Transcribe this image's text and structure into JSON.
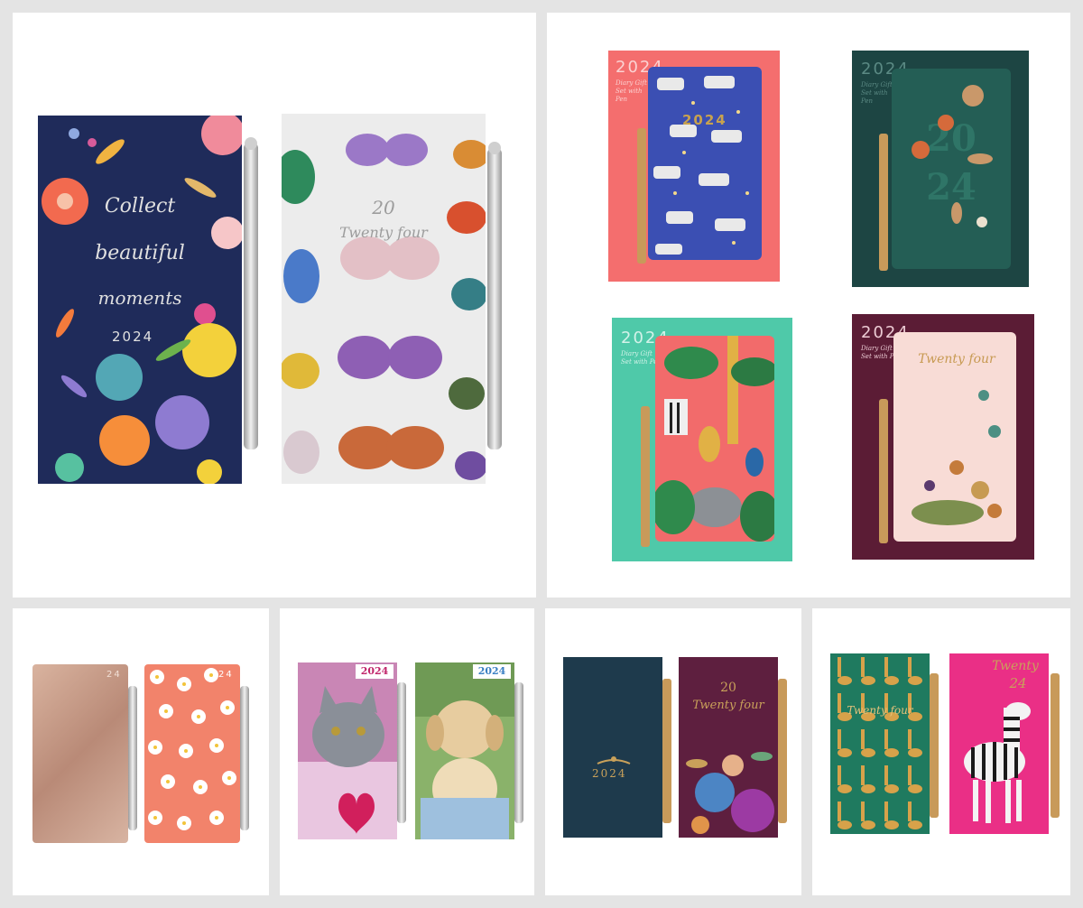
{
  "products": {
    "floral_slim": {
      "line1": "Collect",
      "line2": "beautiful",
      "line3": "moments",
      "year": "2024"
    },
    "butterfly_slim": {
      "top": "20",
      "bottom": "Twenty four"
    },
    "zebra_box": {
      "box_year": "2024",
      "box_label": "Diary Gift Set with Pen",
      "cover_year": "2024"
    },
    "green_box": {
      "box_year": "2024",
      "box_label": "Diary Gift Set with Pen",
      "cover_top": "20",
      "cover_bottom": "24"
    },
    "jungle_box": {
      "box_year": "2024",
      "box_label": "Diary Gift Set with Pen"
    },
    "plum_box": {
      "box_year": "2024",
      "box_label": "Diary Gift Set with Pen",
      "cover_text": "Twenty four"
    },
    "rosegold_slim": {
      "corner": "24"
    },
    "daisy_slim": {
      "corner": "24"
    },
    "kitten_slim": {
      "badge": "2024"
    },
    "puppy_slim": {
      "badge": "2024"
    },
    "navy_slim": {
      "year": "2024"
    },
    "plum_slim": {
      "top": "20",
      "bottom": "Twenty four"
    },
    "giraffe_slim": {
      "text": "Twenty four"
    },
    "pink_zebra_slim": {
      "top": "Twenty",
      "bottom": "24"
    }
  },
  "colors": {
    "navy": "#1f2b5a",
    "coral": "#f46e6e",
    "teal_green": "#20524b",
    "mint": "#4fc9a9",
    "plum": "#5b1c35",
    "hot_pink": "#ea2f86",
    "giraffe_green": "#1f7a5f"
  }
}
